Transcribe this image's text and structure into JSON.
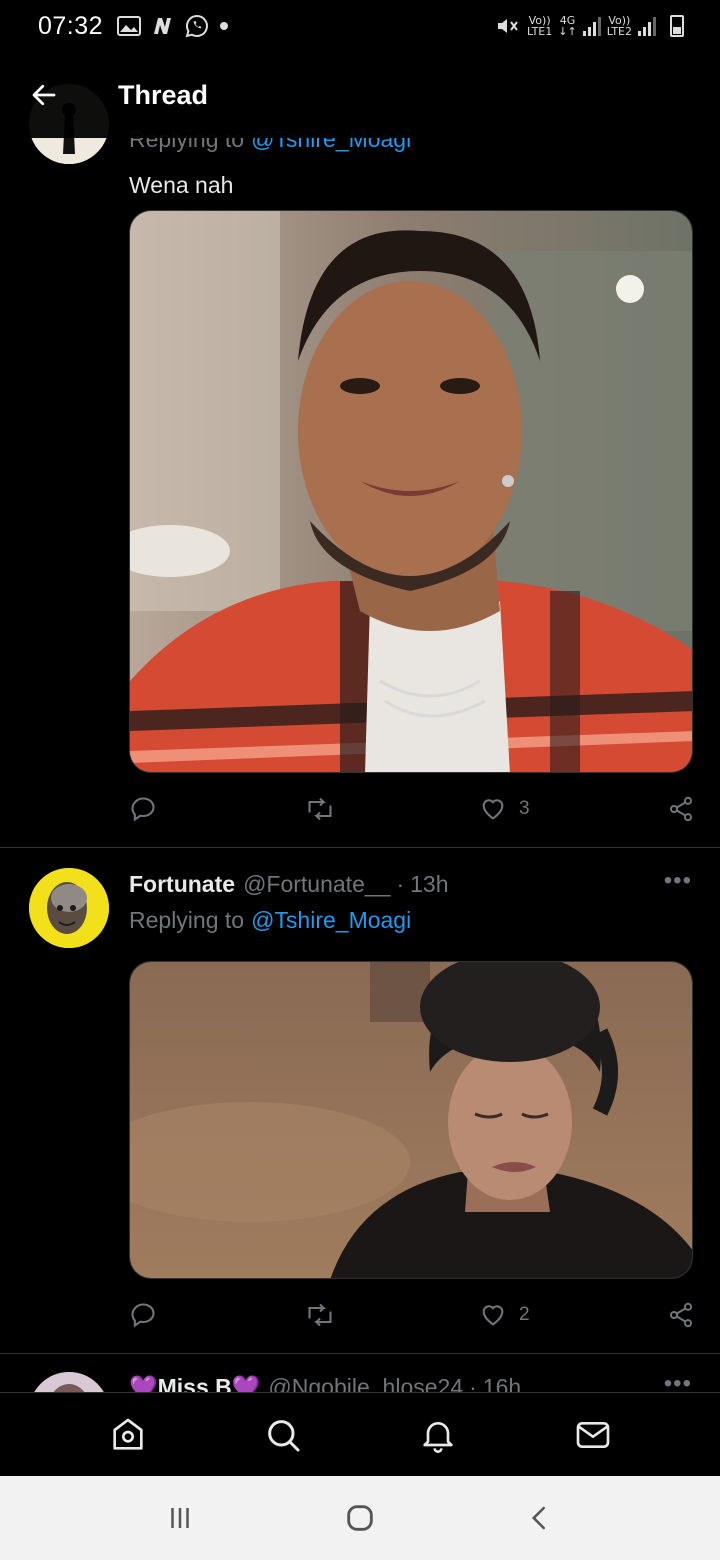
{
  "status_bar": {
    "time": "07:32",
    "left_icons": [
      "gallery-icon",
      "n-notification-icon",
      "whatsapp-icon",
      "dot-icon"
    ],
    "sim1_label_top": "Vo))",
    "sim1_label_bottom": "LTE1",
    "network_label_top": "4G",
    "network_label_bottom": "↓↑",
    "sim2_label_top": "Vo))",
    "sim2_label_bottom": "LTE2"
  },
  "header": {
    "title": "Thread",
    "back_icon": "back-arrow-icon"
  },
  "tweets": [
    {
      "reply_prefix": "Replying to",
      "reply_handle": "@Tshire_Moagi",
      "text": "Wena nah",
      "media_desc": "smiling-man-photo",
      "reply_count": "",
      "retweet_count": "",
      "like_count": "3"
    },
    {
      "display_name": "Fortunate",
      "handle": "@Fortunate__",
      "separator": "·",
      "time": "13h",
      "reply_prefix": "Replying to",
      "reply_handle": "@Tshire_Moagi",
      "media_desc": "crying-woman-photo",
      "like_count": "2",
      "more": "•••"
    },
    {
      "display_name": "💜Miss B💜",
      "handle": "@Ngobile_hlose24",
      "separator": "·",
      "time": "16h",
      "more": "•••"
    }
  ],
  "bottom_nav": [
    "home-icon",
    "search-icon",
    "notifications-icon",
    "messages-icon"
  ],
  "system_nav": [
    "recents-icon",
    "home-circle-icon",
    "back-chevron-icon"
  ],
  "colors": {
    "background": "#000000",
    "link": "#1d9bf0",
    "muted": "#71767b",
    "text": "#e7e9ea"
  }
}
